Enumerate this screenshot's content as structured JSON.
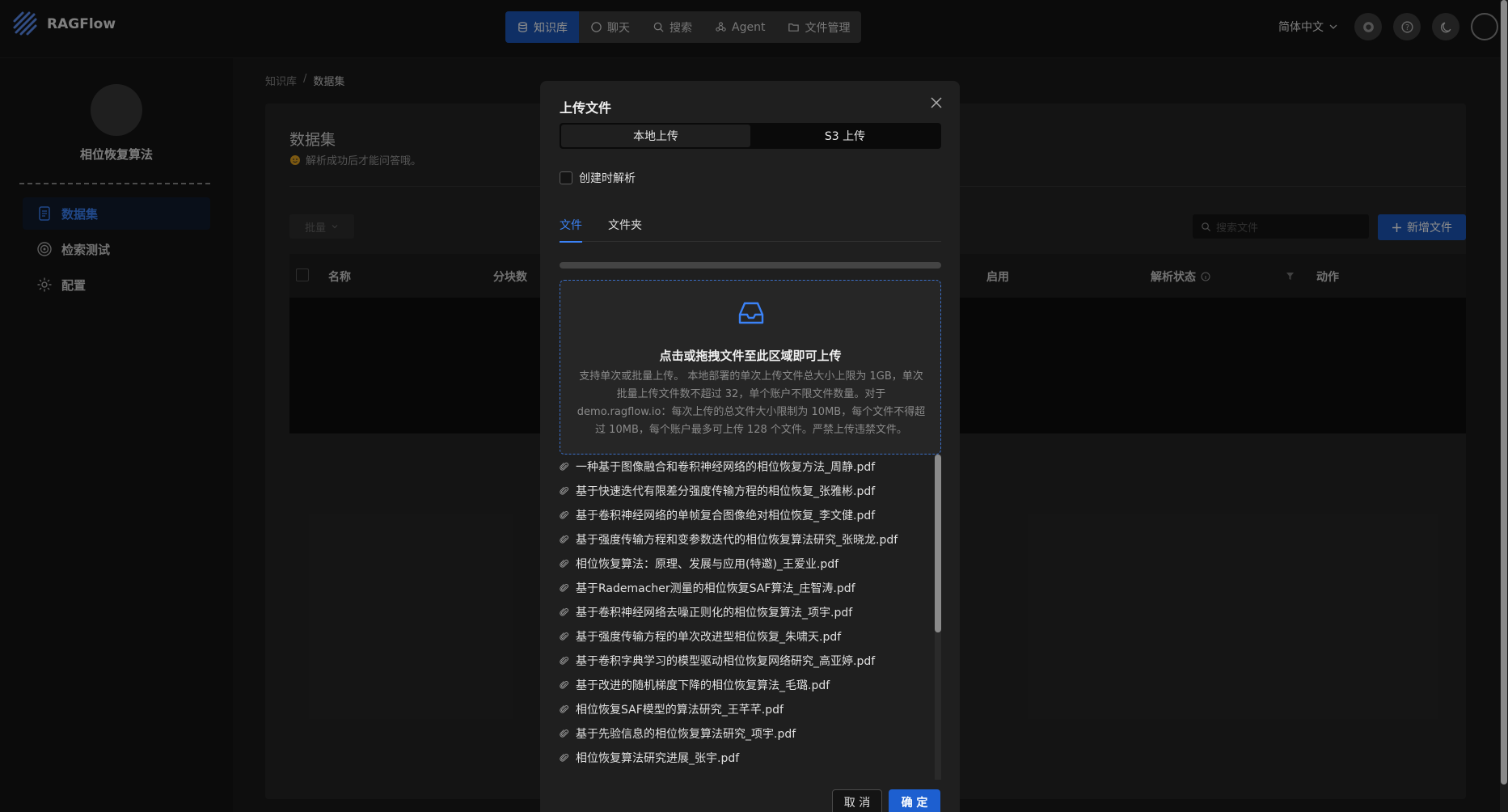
{
  "app": {
    "name": "RAGFlow"
  },
  "nav": {
    "items": [
      {
        "label": "知识库",
        "active": true
      },
      {
        "label": "聊天",
        "active": false
      },
      {
        "label": "搜索",
        "active": false
      },
      {
        "label": "Agent",
        "active": false
      },
      {
        "label": "文件管理",
        "active": false
      }
    ]
  },
  "topbar": {
    "language": "简体中文"
  },
  "sidebar": {
    "kb_name": "相位恢复算法",
    "items": [
      {
        "label": "数据集",
        "active": true
      },
      {
        "label": "检索测试",
        "active": false
      },
      {
        "label": "配置",
        "active": false
      }
    ]
  },
  "breadcrumb": {
    "root": "知识库",
    "separator": "/",
    "current": "数据集"
  },
  "dataset": {
    "title": "数据集",
    "subtitle": "解析成功后才能问答哦。",
    "bulk_label": "批量",
    "search_placeholder": "搜索文件",
    "add_label": "新增文件",
    "columns": [
      "名称",
      "分块数",
      "启用",
      "解析状态",
      "动作"
    ]
  },
  "modal": {
    "title": "上传文件",
    "segments": [
      "本地上传",
      "S3 上传"
    ],
    "parse_on_create": "创建时解析",
    "tabs": [
      "文件",
      "文件夹"
    ],
    "drop_title": "点击或拖拽文件至此区域即可上传",
    "drop_hint": "支持单次或批量上传。 本地部署的单次上传文件总大小上限为 1GB，单次批量上传文件数不超过 32，单个账户不限文件数量。对于 demo.ragflow.io：每次上传的总文件大小限制为 10MB，每个文件不得超过 10MB，每个账户最多可上传 128 个文件。严禁上传违禁文件。",
    "files": [
      "一种基于图像融合和卷积神经网络的相位恢复方法_周静.pdf",
      "基于快速迭代有限差分强度传输方程的相位恢复_张雅彬.pdf",
      "基于卷积神经网络的单帧复合图像绝对相位恢复_李文健.pdf",
      "基于强度传输方程和变参数迭代的相位恢复算法研究_张晓龙.pdf",
      "相位恢复算法：原理、发展与应用(特邀)_王爱业.pdf",
      "基于Rademacher测量的相位恢复SAF算法_庄智涛.pdf",
      "基于卷积神经网络去噪正则化的相位恢复算法_项宇.pdf",
      "基于强度传输方程的单次改进型相位恢复_朱啸天.pdf",
      "基于卷积字典学习的模型驱动相位恢复网络研究_高亚婷.pdf",
      "基于改进的随机梯度下降的相位恢复算法_毛璐.pdf",
      "相位恢复SAF模型的算法研究_王芊芊.pdf",
      "基于先验信息的相位恢复算法研究_项宇.pdf",
      "相位恢复算法研究进展_张宇.pdf"
    ],
    "cancel_label": "取 消",
    "ok_label": "确 定"
  },
  "colors": {
    "accent": "#1d57b8",
    "link": "#3b82f6"
  }
}
